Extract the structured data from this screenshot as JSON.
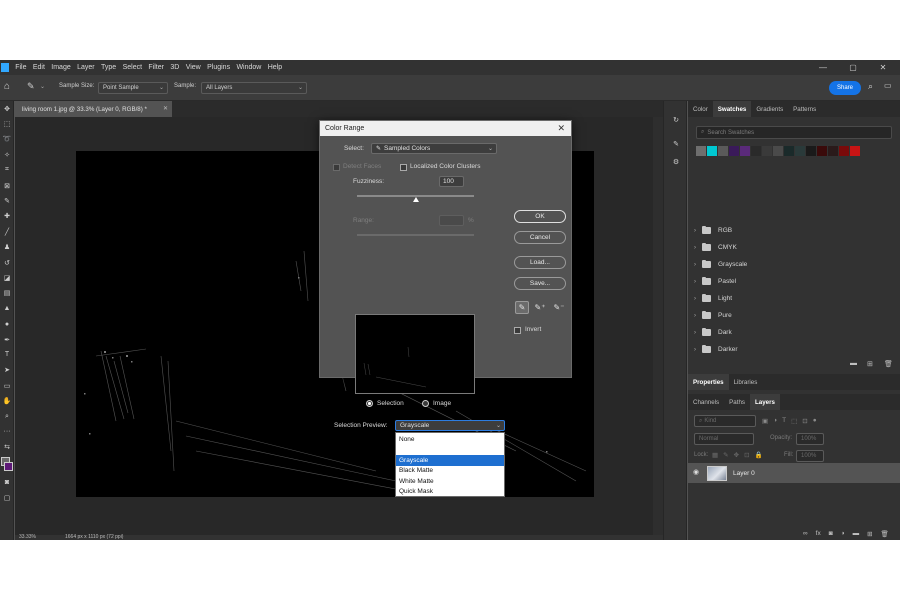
{
  "menubar": {
    "items": [
      "File",
      "Edit",
      "Image",
      "Layer",
      "Type",
      "Select",
      "Filter",
      "3D",
      "View",
      "Plugins",
      "Window",
      "Help"
    ]
  },
  "window_controls": [
    "—",
    "▢",
    "✕"
  ],
  "options_bar": {
    "sample_size_label": "Sample Size:",
    "sample_size_value": "Point Sample",
    "sample_label": "Sample:",
    "sample_value": "All Layers",
    "share_label": "Share"
  },
  "document": {
    "tab_title": "living room 1.jpg @ 33.3% (Layer 0, RGB/8) *",
    "zoom": "33.33%",
    "status_text": "1664 px x 1110 px (72 ppi)"
  },
  "swatches_panel": {
    "tabs": [
      "Color",
      "Swatches",
      "Gradients",
      "Patterns"
    ],
    "active_tab": "Swatches",
    "search_placeholder": "Search Swatches",
    "recent_colors": [
      "#6e6e6e",
      "#00c8d2",
      "#5a5a5a",
      "#3a1a5a",
      "#5a2a7a",
      "#2a2a2a",
      "#3a3a3a",
      "#4a4a4a",
      "#1a2a2a",
      "#2a3a3a",
      "#1a1a1a",
      "#3a0a0a",
      "#2a1a1a",
      "#7a0a0a",
      "#c81414"
    ],
    "folders": [
      "RGB",
      "CMYK",
      "Grayscale",
      "Pastel",
      "Light",
      "Pure",
      "Dark",
      "Darker"
    ]
  },
  "properties_panel": {
    "tabs": [
      "Properties",
      "Libraries"
    ],
    "active_tab": "Properties"
  },
  "layers_panel": {
    "tabs": [
      "Channels",
      "Paths",
      "Layers"
    ],
    "active_tab": "Layers",
    "kind_filter": "Kind",
    "blend_mode": "Normal",
    "opacity_label": "Opacity:",
    "opacity_value": "100%",
    "lock_label": "Lock:",
    "fill_label": "Fill:",
    "fill_value": "100%",
    "layers": [
      {
        "name": "Layer 0"
      }
    ]
  },
  "color_range_dialog": {
    "title": "Color Range",
    "select_label": "Select:",
    "select_value": "Sampled Colors",
    "detect_faces_label": "Detect Faces",
    "localized_label": "Localized Color Clusters",
    "fuzziness_label": "Fuzziness:",
    "fuzziness_value": "100",
    "fuzziness_fraction": 0.5,
    "range_label": "Range:",
    "range_unit": "%",
    "selection_radio_label": "Selection",
    "image_radio_label": "Image",
    "selection_radio_selected": true,
    "preview_label": "Selection Preview:",
    "preview_value": "Grayscale",
    "buttons": {
      "ok": "OK",
      "cancel": "Cancel",
      "load": "Load...",
      "save": "Save..."
    },
    "invert_label": "Invert",
    "preview_options": [
      "None",
      "Grayscale",
      "Black Matte",
      "White Matte",
      "Quick Mask"
    ],
    "preview_selected": "Grayscale"
  }
}
